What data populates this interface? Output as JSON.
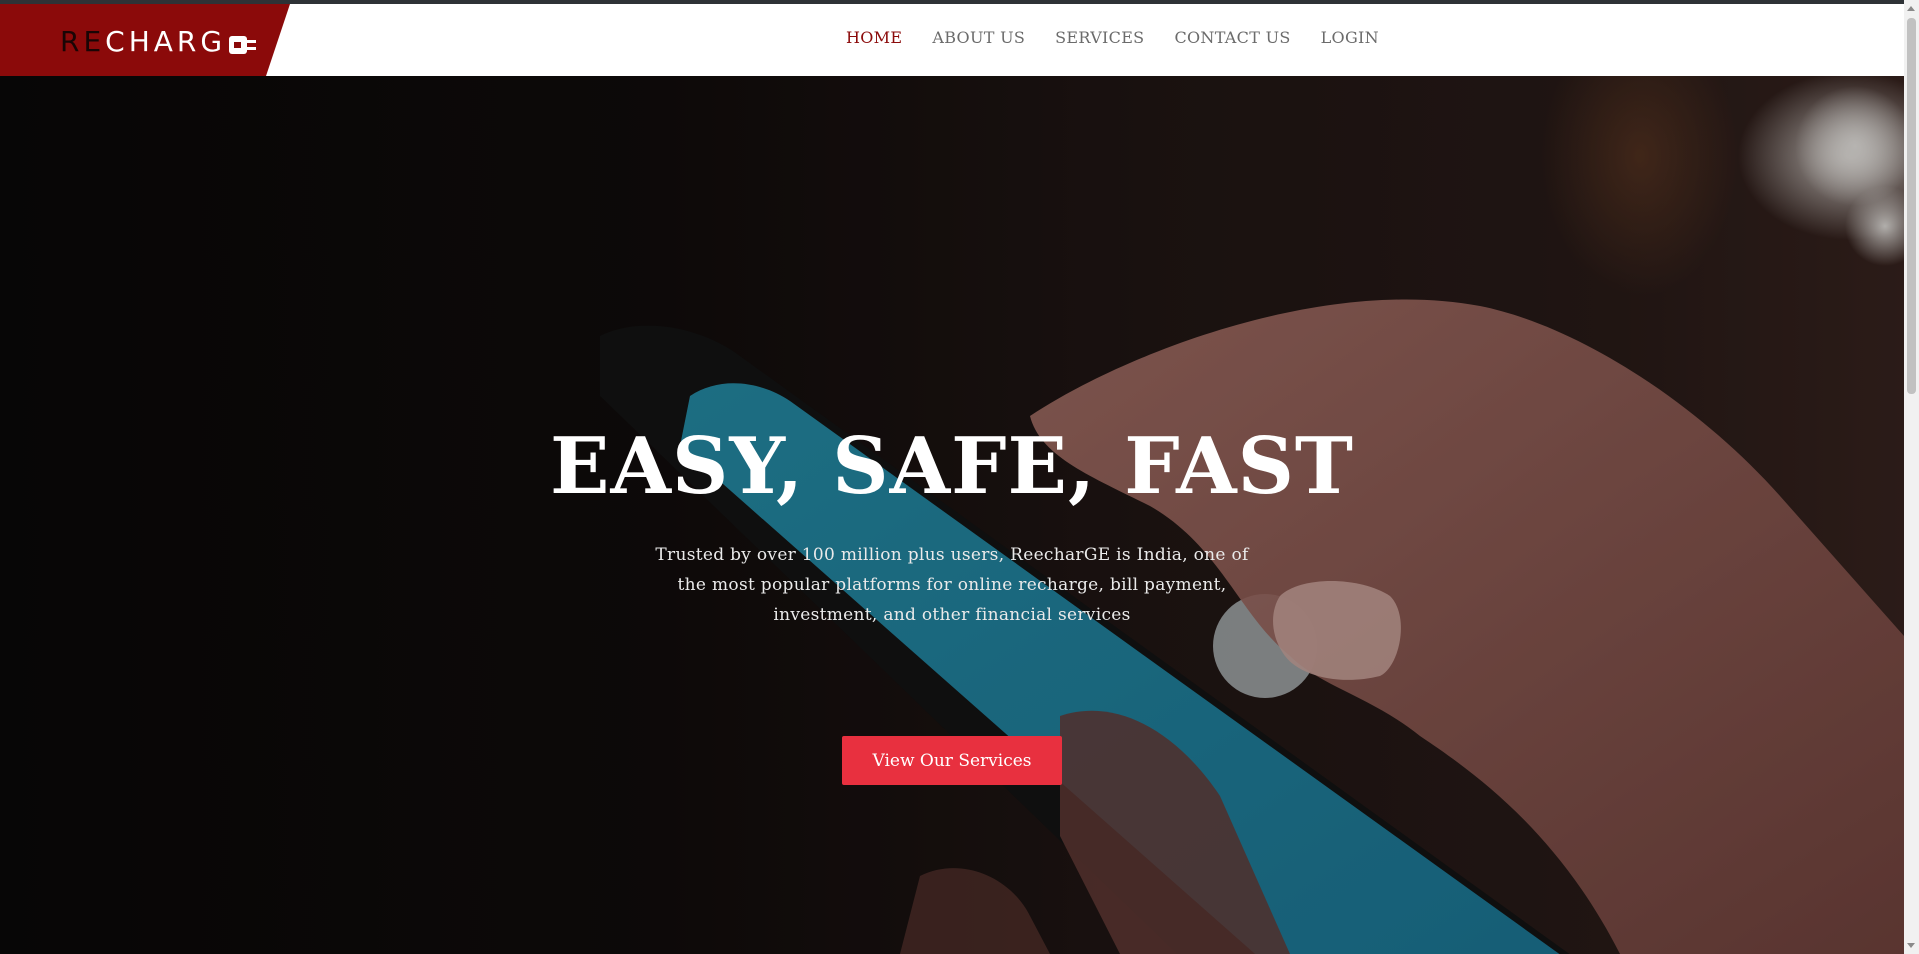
{
  "header": {
    "logo": {
      "part_dark": "RE",
      "part_light": "CHARG",
      "icon": "plug-icon"
    },
    "nav": [
      {
        "label": "HOME",
        "active": true
      },
      {
        "label": "ABOUT US",
        "active": false
      },
      {
        "label": "SERVICES",
        "active": false
      },
      {
        "label": "CONTACT US",
        "active": false
      },
      {
        "label": "LOGIN",
        "active": false
      }
    ]
  },
  "hero": {
    "title": "EASY, SAFE, FAST",
    "text": "Trusted by over 100 million plus users, ReecharGE is India, one of the most popular platforms for online recharge, bill payment, investment, and other financial services",
    "button_label": "View Our Services",
    "background_image": "hand-holding-smartphone"
  },
  "colors": {
    "brand": "#8b0a0a",
    "accent_button": "#e8303f",
    "nav_text": "#6b6b6b"
  }
}
